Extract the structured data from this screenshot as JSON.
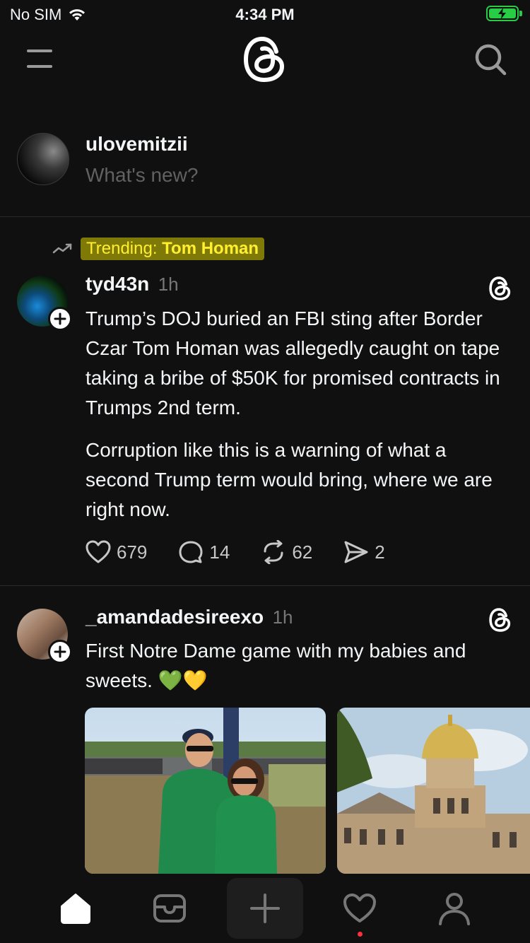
{
  "status_bar": {
    "carrier": "No SIM",
    "time": "4:34 PM",
    "battery_color": "#29cc45"
  },
  "header": {
    "menu_icon": "hamburger-menu-icon",
    "logo_icon": "threads-logo-icon",
    "search_icon": "search-icon"
  },
  "composer": {
    "username": "ulovemitzii",
    "placeholder": "What's new?"
  },
  "posts": [
    {
      "trending_label": "Trending:",
      "trending_topic": "Tom Homan",
      "username": "tyd43n",
      "time": "1h",
      "paragraphs": [
        "Trump’s DOJ buried an FBI sting after Border Czar Tom Homan was allegedly caught on tape taking a bribe of $50K for promised contracts in Trumps 2nd term.",
        "Corruption like this is a warning of what a second Trump term would bring, where we are right now."
      ],
      "likes": "679",
      "comments": "14",
      "reposts": "62",
      "shares": "2"
    },
    {
      "username": "_amandadesireexo",
      "time": "1h",
      "text": "First Notre Dame game with my babies and sweets. 💚💛"
    }
  ],
  "tab_bar": {
    "items": [
      "home-icon",
      "inbox-icon",
      "compose-icon",
      "activity-icon",
      "profile-icon"
    ],
    "accent": "#ff3040"
  }
}
